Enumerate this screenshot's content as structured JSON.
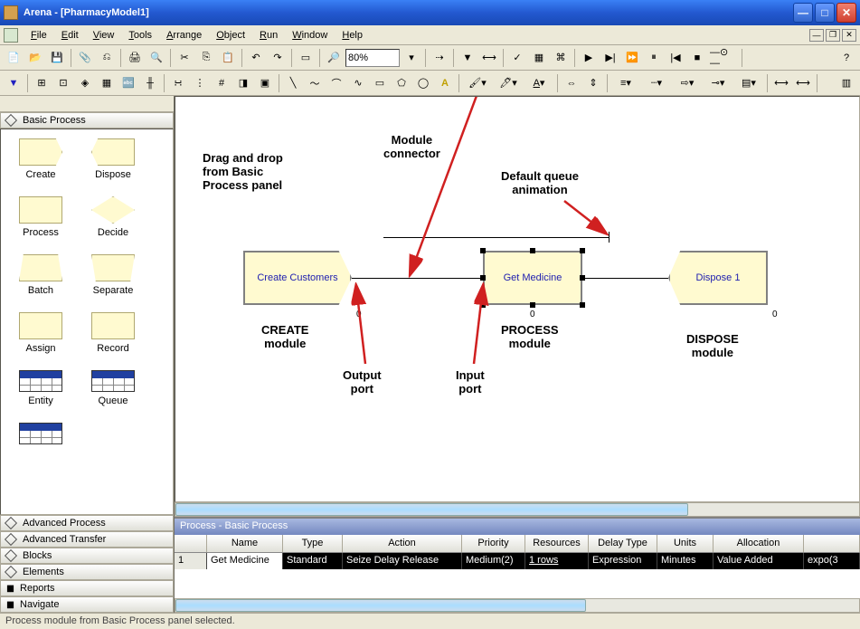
{
  "window": {
    "title": "Arena - [PharmacyModel1]"
  },
  "menus": {
    "file": "File",
    "edit": "Edit",
    "view": "View",
    "tools": "Tools",
    "arrange": "Arrange",
    "object": "Object",
    "run": "Run",
    "window": "Window",
    "help": "Help"
  },
  "toolbar": {
    "zoom": "80%"
  },
  "panels": {
    "basic_process": "Basic Process",
    "advanced_process": "Advanced Process",
    "advanced_transfer": "Advanced Transfer",
    "blocks": "Blocks",
    "elements": "Elements",
    "reports": "Reports",
    "navigate": "Navigate"
  },
  "modules": {
    "create": "Create",
    "dispose": "Dispose",
    "process": "Process",
    "decide": "Decide",
    "batch": "Batch",
    "separate": "Separate",
    "assign": "Assign",
    "record": "Record",
    "entity": "Entity",
    "queue": "Queue"
  },
  "diagram": {
    "create_label": "Create Customers",
    "process_label": "Get Medicine",
    "dispose_label": "Dispose 1",
    "zero1": "0",
    "zero2": "0",
    "zero3": "0",
    "annot_drag": "Drag and drop\nfrom Basic\nProcess panel",
    "annot_connector": "Module\nconnector",
    "annot_queue": "Default queue\nanimation",
    "annot_create": "CREATE\nmodule",
    "annot_process": "PROCESS\nmodule",
    "annot_dispose": "DISPOSE\nmodule",
    "annot_output": "Output\nport",
    "annot_input": "Input\nport"
  },
  "grid": {
    "title": "Process - Basic Process",
    "headers": {
      "name": "Name",
      "type": "Type",
      "action": "Action",
      "priority": "Priority",
      "resources": "Resources",
      "delay_type": "Delay Type",
      "units": "Units",
      "allocation": "Allocation"
    },
    "row": {
      "num": "1",
      "name": "Get Medicine",
      "type": "Standard",
      "action": "Seize Delay Release",
      "priority": "Medium(2)",
      "resources": "1 rows",
      "delay_type": "Expression",
      "units": "Minutes",
      "allocation": "Value Added",
      "rest": "expo(3"
    }
  },
  "status": "Process module from Basic Process panel selected."
}
